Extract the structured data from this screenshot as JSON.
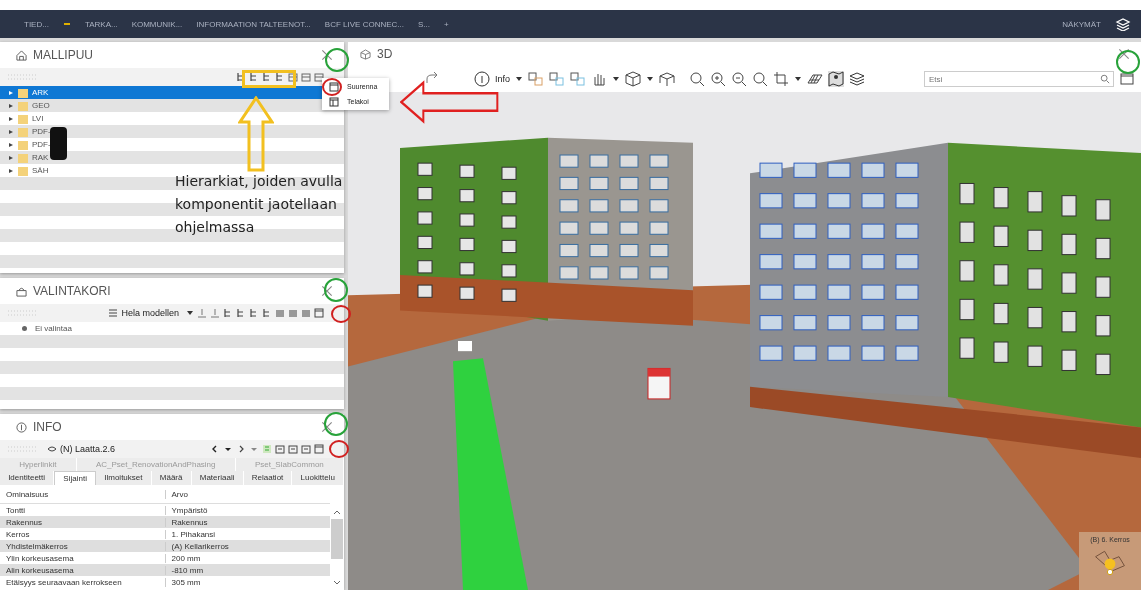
{
  "top_bar": {
    "tabs": [
      "TIED...",
      "TARKA...",
      "KOMMUNIK...",
      "INFORMAATION TALTEENOT...",
      "BCF LIVE CONNEC...",
      "S..."
    ],
    "add_tab": "+",
    "views_label": "NÄKYMÄT"
  },
  "model_tree": {
    "title": "MALLIPUU",
    "items": [
      {
        "label": "ARK",
        "selected": true
      },
      {
        "label": "GEO",
        "selected": false
      },
      {
        "label": "LVI",
        "selected": false
      },
      {
        "label": "PDF-",
        "selected": false
      },
      {
        "label": "PDF-",
        "selected": false
      },
      {
        "label": "RAK",
        "selected": false
      },
      {
        "label": "SÄH",
        "selected": false
      }
    ]
  },
  "context_menu": {
    "items": [
      "Suurenna",
      "Telakoi"
    ]
  },
  "annotation": "Hierarkiat, joiden avulla komponentit jaotellaan ohjelmassa",
  "selection_basket": {
    "title": "VALINTAKORI",
    "scope": "Hela modellen",
    "rows": [
      "Ei valintaa"
    ]
  },
  "info": {
    "title": "INFO",
    "component": "(N) Laatta.2.6",
    "tabs_top": [
      {
        "label": "Hyperlinkit",
        "selected": false
      },
      {
        "label": "AC_Pset_RenovationAndPhasing",
        "selected": false
      },
      {
        "label": "Pset_SlabCommon",
        "selected": false
      }
    ],
    "tabs": [
      {
        "label": "Identiteetti",
        "selected": false
      },
      {
        "label": "Sijainti",
        "selected": true
      },
      {
        "label": "Ilmoitukset",
        "selected": false
      },
      {
        "label": "Määrä",
        "selected": false
      },
      {
        "label": "Materiaali",
        "selected": false
      },
      {
        "label": "Relaatiot",
        "selected": false
      },
      {
        "label": "Luokittelu",
        "selected": false
      }
    ],
    "columns": [
      "Ominaisuus",
      "Arvo"
    ],
    "rows": [
      [
        "Tontti",
        "Ympäristö"
      ],
      [
        "Rakennus",
        "Rakennus"
      ],
      [
        "Kerros",
        "1. Pihakansi"
      ],
      [
        "Yhdistelmäkerros",
        "(A) Kellarikerros"
      ],
      [
        "Ylin korkeusasema",
        "200 mm"
      ],
      [
        "Alin korkeusasema",
        "-810 mm"
      ],
      [
        "Etäisyys seuraavaan kerrokseen",
        "305 mm"
      ]
    ]
  },
  "view_3d": {
    "title": "3D",
    "info_button": "Info",
    "search": {
      "placeholder": "Etsi"
    },
    "navigator_label": "(B) 6. Kerros"
  }
}
